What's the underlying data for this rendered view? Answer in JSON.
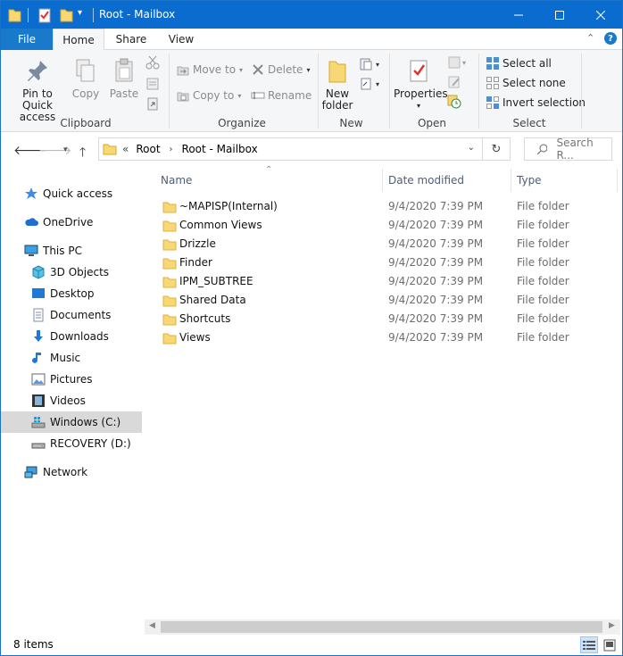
{
  "window": {
    "title": "Root - Mailbox",
    "accent": "#0b6cd0"
  },
  "ribbon_tabs": {
    "file": "File",
    "home": "Home",
    "share": "Share",
    "view": "View"
  },
  "clipboard": {
    "label": "Clipboard",
    "pin_line1": "Pin to Quick",
    "pin_line2": "access",
    "copy": "Copy",
    "paste": "Paste"
  },
  "organize": {
    "label": "Organize",
    "move_to": "Move to",
    "copy_to": "Copy to",
    "delete": "Delete",
    "rename": "Rename"
  },
  "new": {
    "label": "New",
    "new_folder_line1": "New",
    "new_folder_line2": "folder"
  },
  "open": {
    "label": "Open",
    "properties": "Properties"
  },
  "select": {
    "label": "Select",
    "select_all": "Select all",
    "select_none": "Select none",
    "invert": "Invert selection"
  },
  "address": {
    "overflow": "«",
    "crumb1": "Root",
    "crumb2": "Root - Mailbox",
    "search_placeholder": "Search R..."
  },
  "nav": {
    "quick_access": "Quick access",
    "onedrive": "OneDrive",
    "this_pc": "This PC",
    "objects3d": "3D Objects",
    "desktop": "Desktop",
    "documents": "Documents",
    "downloads": "Downloads",
    "music": "Music",
    "pictures": "Pictures",
    "videos": "Videos",
    "windows_c": "Windows (C:)",
    "recovery_d": "RECOVERY (D:)",
    "network": "Network"
  },
  "columns": {
    "name": "Name",
    "date": "Date modified",
    "type": "Type"
  },
  "files": [
    {
      "name": "~MAPISP(Internal)",
      "date": "9/4/2020 7:39 PM",
      "type": "File folder"
    },
    {
      "name": "Common Views",
      "date": "9/4/2020 7:39 PM",
      "type": "File folder"
    },
    {
      "name": "Drizzle",
      "date": "9/4/2020 7:39 PM",
      "type": "File folder"
    },
    {
      "name": "Finder",
      "date": "9/4/2020 7:39 PM",
      "type": "File folder"
    },
    {
      "name": "IPM_SUBTREE",
      "date": "9/4/2020 7:39 PM",
      "type": "File folder"
    },
    {
      "name": "Shared Data",
      "date": "9/4/2020 7:39 PM",
      "type": "File folder"
    },
    {
      "name": "Shortcuts",
      "date": "9/4/2020 7:39 PM",
      "type": "File folder"
    },
    {
      "name": "Views",
      "date": "9/4/2020 7:39 PM",
      "type": "File folder"
    }
  ],
  "status": {
    "item_count": "8 items"
  }
}
